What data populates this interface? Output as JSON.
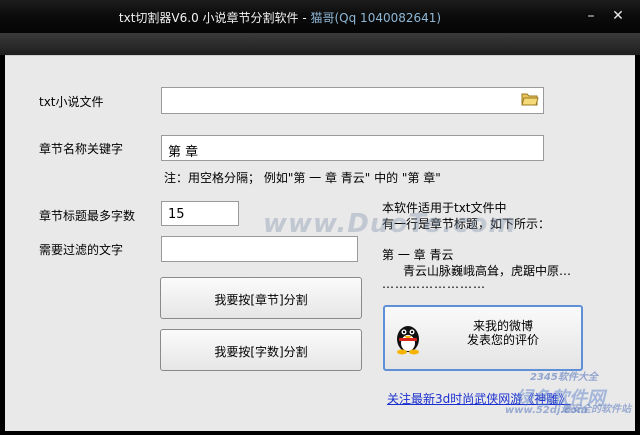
{
  "window": {
    "title": "txt切割器V6.0 小说章节分割软件",
    "title_sep": " - ",
    "title_author": "猫哥(Qq 1040082641)",
    "min_glyph": "–",
    "close_glyph": "✕"
  },
  "form": {
    "file_label": "txt小说文件",
    "file_value": "",
    "keyword_label": "章节名称关键字",
    "keyword_value": "第 章",
    "keyword_note": "注：用空格分隔；    例如\"第 一 章  青云\" 中的 \"第 章\"",
    "maxlen_label": "章节标题最多字数",
    "maxlen_value": "15",
    "filter_label": "需要过滤的文字",
    "filter_value": ""
  },
  "info": {
    "line1": "本软件适用于txt文件中",
    "line2": "有一行是章节标题，如下所示：",
    "example_title": "第 一 章  青云",
    "example_body": "青云山脉巍峨高耸，虎踞中原…",
    "example_dots": "……………………"
  },
  "buttons": {
    "split_chapter": "我要按[章节]分割",
    "split_chars": "我要按[字数]分割",
    "weibo_line1": "来我的微博",
    "weibo_line2": "发表您的评价"
  },
  "footer_link": "关注最新3d时尚武侠网游《神雕》",
  "watermarks": {
    "center": "www.DuoTe.com",
    "corner1": "2345软件大全",
    "corner2": "绿色软件网",
    "corner3": "www.52dj.com",
    "corner4": "最安全的软件站"
  },
  "colors": {
    "accent": "#5f8fd6",
    "link": "#1a2fcf",
    "title_bg": "#0c0c0c"
  },
  "icons": {
    "browse": "folder-icon",
    "qq": "qq-penguin-icon"
  }
}
